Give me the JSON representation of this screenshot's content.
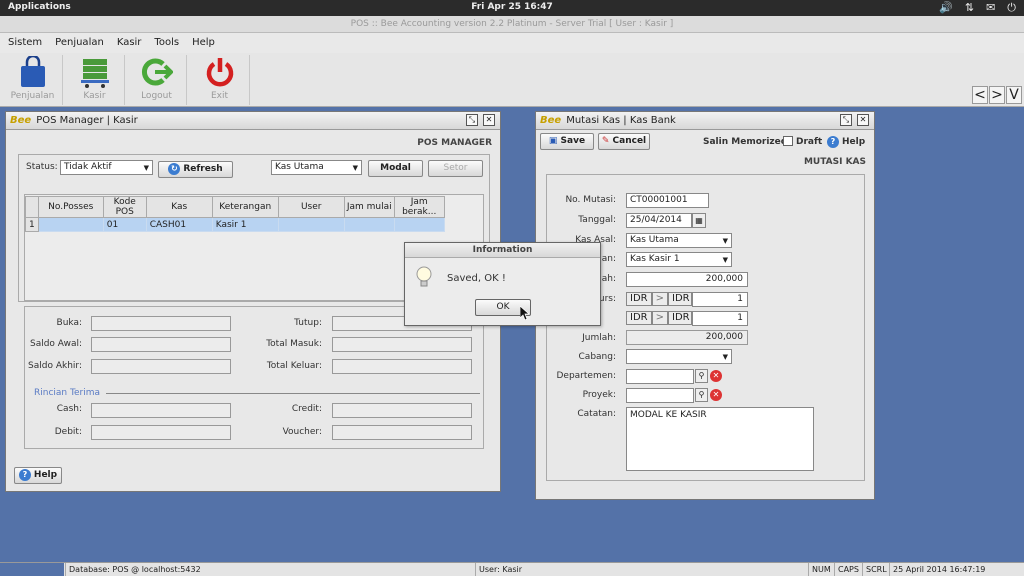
{
  "topbar": {
    "applications": "Applications",
    "clock": "Fri Apr 25 16:47"
  },
  "titlebar": {
    "title": "POS :: Bee Accounting version 2.2 Platinum - Server Trial [ User : Kasir ]"
  },
  "menubar": {
    "items": [
      "Sistem",
      "Penjualan",
      "Kasir",
      "Tools",
      "Help"
    ]
  },
  "toolbar": {
    "buttons": [
      {
        "label": "Penjualan",
        "icon": "shopping-bag-icon"
      },
      {
        "label": "Kasir",
        "icon": "cash-cart-icon"
      },
      {
        "label": "Logout",
        "icon": "logout-arrow-icon"
      },
      {
        "label": "Exit",
        "icon": "power-icon"
      }
    ],
    "nav": [
      "<",
      ">",
      "V"
    ]
  },
  "pos_manager": {
    "logo": "Bee",
    "title": "POS Manager | Kasir",
    "section": "POS MANAGER",
    "status_label": "Status:",
    "status_value": "Tidak Aktif",
    "refresh": "Refresh",
    "kas_value": "Kas Utama",
    "modal": "Modal",
    "setor": "Setor",
    "columns": [
      "No.Posses",
      "Kode POS",
      "Kas",
      "Keterangan",
      "User",
      "Jam mulai",
      "Jam berak..."
    ],
    "rows": [
      {
        "num": "1",
        "no_posses": "",
        "kode_pos": "01",
        "kas": "CASH01",
        "keterangan": "Kasir 1",
        "user": "",
        "jam_mulai": "",
        "jam_berakhir": ""
      }
    ],
    "labels": {
      "buka": "Buka:",
      "saldo_awal": "Saldo Awal:",
      "saldo_akhir": "Saldo Akhir:",
      "tutup": "Tutup:",
      "total_masuk": "Total Masuk:",
      "total_keluar": "Total Keluar:",
      "rincian": "Rincian Terima",
      "cash": "Cash:",
      "debit": "Debit:",
      "credit": "Credit:",
      "voucher": "Voucher:"
    },
    "help": "Help"
  },
  "mutasi": {
    "logo": "Bee",
    "title": "Mutasi Kas | Kas Bank",
    "save": "Save",
    "cancel": "Cancel",
    "salin": "Salin Memorized",
    "draft": "Draft",
    "help": "Help",
    "section": "MUTASI KAS",
    "labels": {
      "no_mutasi": "No. Mutasi:",
      "tanggal": "Tanggal:",
      "kas_asal": "Kas Asal:",
      "kas_tujuan": "uan:",
      "jumlah1": "lah:",
      "kurs": "urs:",
      "jumlah2": "Jumlah:",
      "cabang": "Cabang:",
      "departemen": "Departemen:",
      "proyek": "Proyek:",
      "catatan": "Catatan:"
    },
    "values": {
      "no_mutasi": "CT00001001",
      "tanggal": "25/04/2014",
      "kas_asal": "Kas Utama",
      "kas_tujuan": "Kas Kasir 1",
      "jumlah1": "200,000",
      "kurs1_from": "IDR",
      "kurs1_to": "IDR",
      "kurs1_rate": "1",
      "kurs2_from": "IDR",
      "kurs2_to": "IDR",
      "kurs2_rate": "1",
      "jumlah2": "200,000",
      "catatan": "MODAL KE KASIR",
      "arrow": ">"
    }
  },
  "dialog": {
    "title": "Information",
    "message": "Saved, OK !",
    "ok": "OK"
  },
  "statusbar": {
    "database": "Database: POS @ localhost:5432",
    "user": "User: Kasir",
    "num": "NUM",
    "caps": "CAPS",
    "scrl": "SCRL",
    "datetime": "25 April 2014  16:47:19"
  }
}
